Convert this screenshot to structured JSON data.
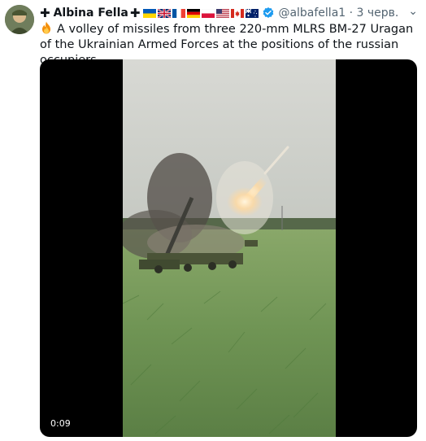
{
  "header": {
    "prefix_cross": "✚",
    "name": "Albina Fella",
    "suffix_cross": "✚",
    "handle": "@albafella1",
    "separator": "·",
    "time": "3 черв."
  },
  "flags": [
    "flag-ukraine-icon",
    "flag-uk-icon",
    "flag-france-icon",
    "flag-germany-icon",
    "flag-poland-icon",
    "flag-usa-icon",
    "flag-canada-icon",
    "flag-australia-icon"
  ],
  "tweet": {
    "text": "A volley of missiles from three 220-mm MLRS BM-27 Uragan of the Ukrainian Armed Forces at the positions of the russian occupiers."
  },
  "video": {
    "duration": "0:09"
  },
  "colors": {
    "verified": "#1d9bf0",
    "secondary_text": "#536471"
  }
}
